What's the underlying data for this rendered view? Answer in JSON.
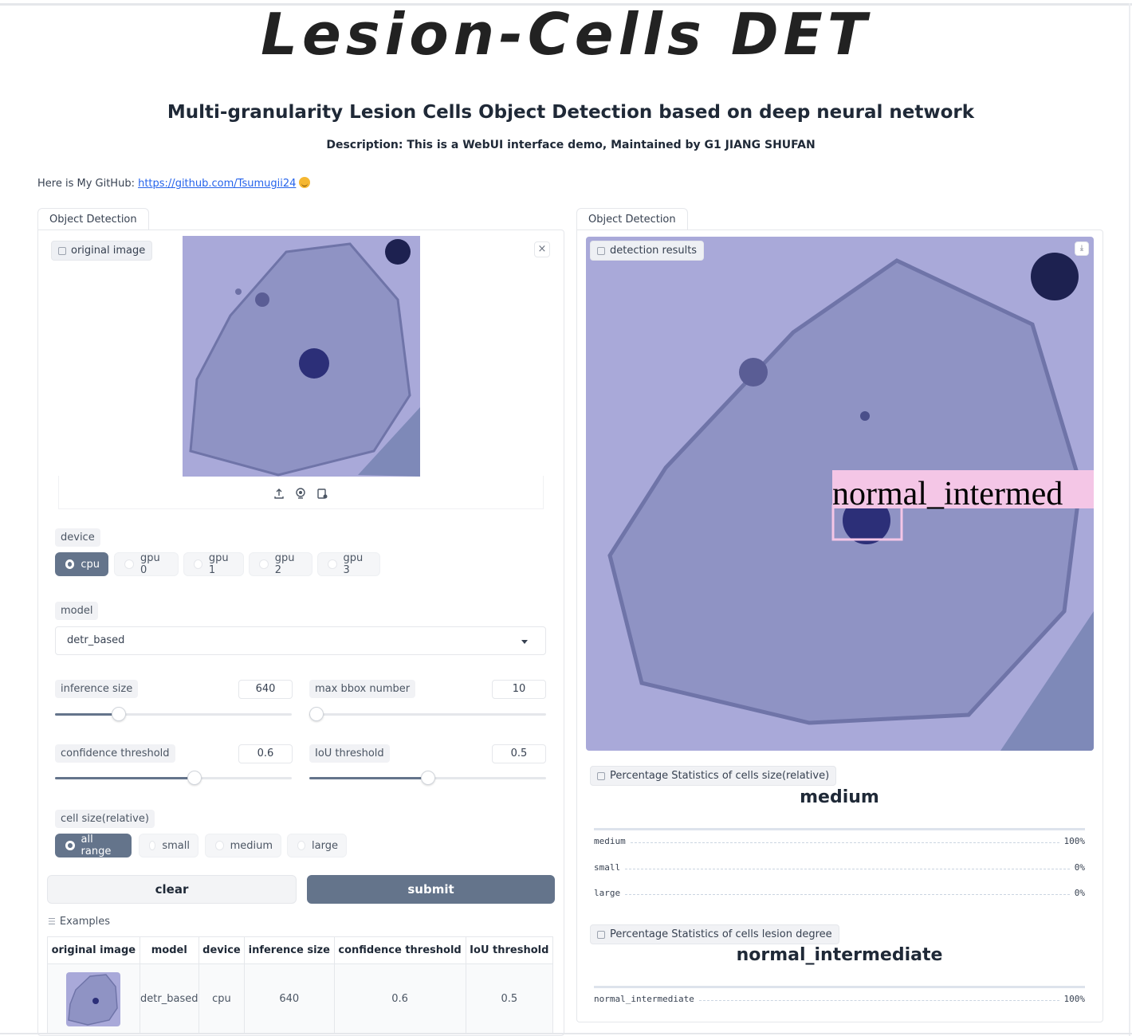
{
  "header": {
    "logo_text": "Lesion-Cells DET",
    "subtitle": "Multi-granularity Lesion Cells Object Detection based on deep neural network",
    "description": "Description: This is a WebUI interface demo, Maintained by G1 JIANG SHUFAN",
    "github_prefix": "Here is My GitHub: ",
    "github_link": "https://github.com/Tsumugii24"
  },
  "left_panel": {
    "tab_label": "Object Detection",
    "image_label": "original image",
    "device": {
      "label": "device",
      "options": [
        "cpu",
        "gpu 0",
        "gpu 1",
        "gpu 2",
        "gpu 3"
      ],
      "selected": "cpu"
    },
    "model": {
      "label": "model",
      "value": "detr_based"
    },
    "inference_size": {
      "label": "inference size",
      "value": "640",
      "fraction": 0.27
    },
    "max_bbox": {
      "label": "max bbox number",
      "value": "10",
      "fraction": 0.03
    },
    "confidence": {
      "label": "confidence threshold",
      "value": "0.6",
      "fraction": 0.59
    },
    "iou": {
      "label": "IoU threshold",
      "value": "0.5",
      "fraction": 0.5
    },
    "cell_size": {
      "label": "cell size(relative)",
      "options": [
        "all range",
        "small",
        "medium",
        "large"
      ],
      "selected": "all range"
    },
    "clear_label": "clear",
    "submit_label": "submit",
    "examples": {
      "label": "Examples",
      "headers": [
        "original image",
        "model",
        "device",
        "inference size",
        "confidence threshold",
        "IoU threshold"
      ],
      "rows": [
        {
          "model": "detr_based",
          "device": "cpu",
          "inference_size": "640",
          "confidence": "0.6",
          "iou": "0.5"
        }
      ]
    }
  },
  "right_panel": {
    "tab_label": "Object Detection",
    "image_label": "detection results",
    "detection_label": "normal_intermed",
    "size_stats": {
      "label": "Percentage Statistics of cells size(relative)",
      "top": "medium",
      "rows": [
        {
          "name": "medium",
          "value": "100%"
        },
        {
          "name": "small",
          "value": "0%"
        },
        {
          "name": "large",
          "value": "0%"
        }
      ]
    },
    "lesion_stats": {
      "label": "Percentage Statistics of cells lesion degree",
      "top": "normal_intermediate",
      "rows": [
        {
          "name": "normal_intermediate",
          "value": "100%"
        }
      ]
    }
  },
  "colors": {
    "accent": "#64748b",
    "cell_background": "#a7a8d8",
    "bbox": "#f4c6e6"
  }
}
